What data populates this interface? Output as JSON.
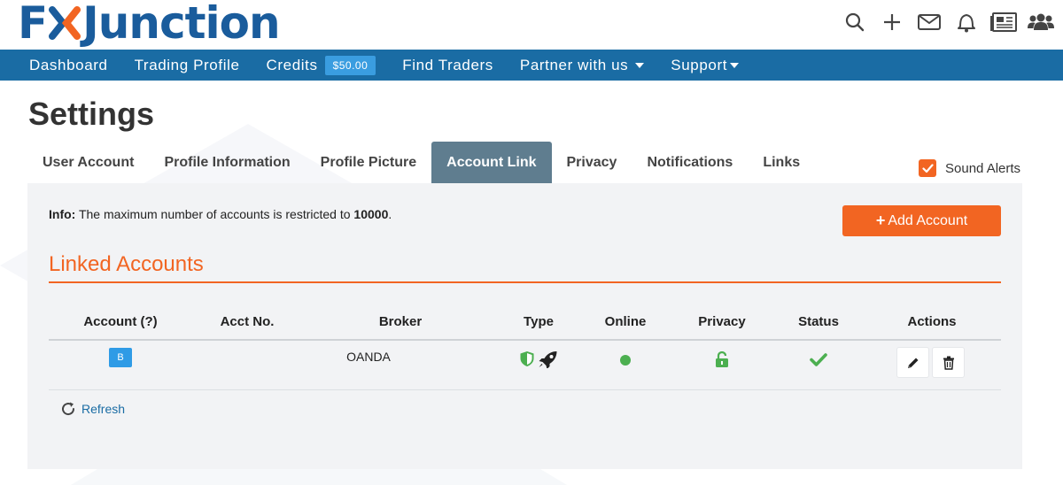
{
  "logo": {
    "text_left": "F",
    "text_right": "Junction",
    "alt": "FXJunction"
  },
  "header_icons": [
    "search-icon",
    "plus-icon",
    "mail-icon",
    "bell-icon",
    "newspaper-icon",
    "users-icon"
  ],
  "nav": {
    "dashboard": "Dashboard",
    "trading_profile": "Trading Profile",
    "credits": "Credits",
    "credits_amount": "$50.00",
    "find_traders": "Find Traders",
    "partner": "Partner with us",
    "support": "Support"
  },
  "page_title": "Settings",
  "tabs": {
    "user_account": "User Account",
    "profile_information": "Profile Information",
    "profile_picture": "Profile Picture",
    "account_link": "Account Link",
    "privacy": "Privacy",
    "notifications": "Notifications",
    "links": "Links"
  },
  "active_tab": "Account Link",
  "sound_alerts": {
    "label": "Sound Alerts",
    "checked": true
  },
  "info": {
    "prefix": "Info:",
    "text": " The maximum number of accounts is restricted to ",
    "limit": "10000",
    "suffix": "."
  },
  "add_account_label": "Add Account",
  "section_title": "Linked Accounts",
  "table": {
    "headers": {
      "account": "Account (?)",
      "acct_no": "Acct No.",
      "broker": "Broker",
      "type": "Type",
      "online": "Online",
      "privacy": "Privacy",
      "status": "Status",
      "actions": "Actions"
    },
    "rows": [
      {
        "account_badge": "B",
        "acct_no": "",
        "broker": "OANDA",
        "type_icons": [
          "shield-icon",
          "rocket-icon"
        ],
        "online": true,
        "privacy_icon": "unlock-icon",
        "status_icon": "check-icon",
        "actions": [
          "edit-icon",
          "trash-icon"
        ]
      }
    ]
  },
  "refresh_label": "Refresh",
  "colors": {
    "brand_blue": "#1a5c9c",
    "nav_blue": "#1a6ca4",
    "accent_orange": "#f26522",
    "active_tab": "#5f7d8f",
    "success_green": "#4caf50",
    "badge_blue": "#2f9be6"
  }
}
